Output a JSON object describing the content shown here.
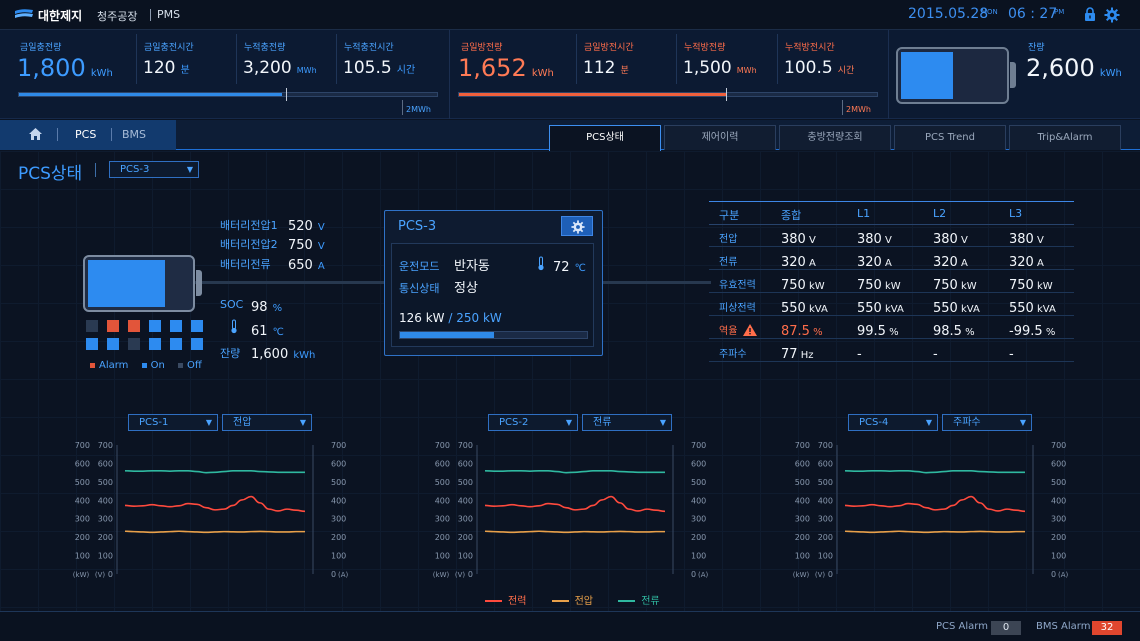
{
  "header": {
    "company": "대한제지",
    "plant": "청주공장",
    "app": "PMS",
    "date": "2015.05.28",
    "day": "MON",
    "time": "06 : 27",
    "ampm": "PM"
  },
  "summary": {
    "charge": {
      "today_label": "금일충전량",
      "today_value": "1,800",
      "today_unit": "kWh",
      "time_label": "금일충전시간",
      "time_value": "120",
      "time_unit": "분",
      "cum_label": "누적충전량",
      "cum_value": "3,200",
      "cum_unit": "MWh",
      "cumtime_label": "누적충전시간",
      "cumtime_value": "105.5",
      "cumtime_unit": "시간",
      "progress": 0.63,
      "scale_label": "2MWh"
    },
    "discharge": {
      "today_label": "금일방전량",
      "today_value": "1,652",
      "today_unit": "kWh",
      "time_label": "금일방전시간",
      "time_value": "112",
      "time_unit": "분",
      "cum_label": "누적방전량",
      "cum_value": "1,500",
      "cum_unit": "MWh",
      "cumtime_label": "누적방전시간",
      "cumtime_value": "100.5",
      "cumtime_unit": "시간",
      "progress": 0.64,
      "scale_label": "2MWh"
    },
    "remain": {
      "label": "잔량",
      "value": "2,600",
      "unit": "kWh",
      "level": 0.5
    }
  },
  "nav": {
    "home_icon": "home-icon",
    "items": [
      "PCS",
      "BMS"
    ],
    "tabs": [
      "PCS상태",
      "제어이력",
      "충방전량조회",
      "PCS Trend",
      "Trip&Alarm"
    ]
  },
  "main": {
    "title": "PCS상태",
    "selector": "PCS-3",
    "battery": {
      "v1_label": "배터리전압1",
      "v1_value": "520",
      "v1_unit": "V",
      "v2_label": "배터리전압2",
      "v2_value": "750",
      "v2_unit": "V",
      "cur_label": "배터리전류",
      "cur_value": "650",
      "cur_unit": "A",
      "soc_label": "SOC",
      "soc_value": "98",
      "soc_unit": "%",
      "temp_value": "61",
      "temp_unit": "℃",
      "remain_label": "잔량",
      "remain_value": "1,600",
      "remain_unit": "kWh",
      "level": 0.75,
      "cells": [
        [
          "off",
          "alarm",
          "alarm",
          "on",
          "on",
          "on"
        ],
        [
          "on",
          "on",
          "off",
          "on",
          "on",
          "on"
        ]
      ],
      "legend": {
        "alarm": "Alarm",
        "on": "On",
        "off": "Off"
      },
      "colors": {
        "alarm": "#e2553a",
        "on": "#2d8bf0",
        "off": "#2a3a52"
      }
    },
    "pcs_card": {
      "title": "PCS-3",
      "mode_label": "운전모드",
      "mode_value": "반자동",
      "temp_value": "72",
      "temp_unit": "℃",
      "comm_label": "통신상태",
      "comm_value": "정상",
      "power_current": "126 kW",
      "power_sep": "/",
      "power_max": "250 kW",
      "progress": 0.5
    },
    "table": {
      "headers": [
        "구분",
        "종합",
        "L1",
        "L2",
        "L3"
      ],
      "rows": [
        {
          "label": "전압",
          "cells": [
            [
              "380",
              "V"
            ],
            [
              "380",
              "V"
            ],
            [
              "380",
              "V"
            ],
            [
              "380",
              "V"
            ]
          ]
        },
        {
          "label": "전류",
          "cells": [
            [
              "320",
              "A"
            ],
            [
              "320",
              "A"
            ],
            [
              "320",
              "A"
            ],
            [
              "320",
              "A"
            ]
          ]
        },
        {
          "label": "유효전력",
          "cells": [
            [
              "750",
              "kW"
            ],
            [
              "750",
              "kW"
            ],
            [
              "750",
              "kW"
            ],
            [
              "750",
              "kW"
            ]
          ]
        },
        {
          "label": "피상전력",
          "cells": [
            [
              "550",
              "kVA"
            ],
            [
              "550",
              "kVA"
            ],
            [
              "550",
              "kVA"
            ],
            [
              "550",
              "kVA"
            ]
          ]
        },
        {
          "label": "역율",
          "alert": true,
          "cells": [
            [
              "87.5",
              "%"
            ],
            [
              "99.5",
              "%"
            ],
            [
              "98.5",
              "%"
            ],
            [
              "-99.5",
              "%"
            ]
          ]
        },
        {
          "label": "주파수",
          "cells": [
            [
              "77",
              "Hz"
            ],
            [
              "-",
              ""
            ],
            [
              "-",
              ""
            ],
            [
              "-",
              ""
            ]
          ]
        }
      ]
    }
  },
  "charts_meta": {
    "panels": [
      {
        "device": "PCS-1",
        "measure": "전압"
      },
      {
        "device": "PCS-2",
        "measure": "전류"
      },
      {
        "device": "PCS-4",
        "measure": "주파수"
      }
    ],
    "left_unit_1": "(kW)",
    "left_unit_2": "(V)",
    "right_unit": "(A)",
    "legend": [
      "전력",
      "전압",
      "전류"
    ],
    "colors": [
      "#ff4a3d",
      "#e8a04a",
      "#2fb8a0"
    ]
  },
  "chart_data": [
    {
      "type": "line",
      "title": "PCS-1",
      "xlabel": "",
      "ylabel": "",
      "ylim": [
        0,
        700
      ],
      "y_ticks": [
        0,
        100,
        200,
        300,
        400,
        500,
        600,
        700
      ],
      "x": [
        0,
        1,
        2,
        3,
        4,
        5,
        6,
        7,
        8,
        9,
        10,
        11,
        12,
        13,
        14,
        15,
        16,
        17,
        18,
        19,
        20
      ],
      "series": [
        {
          "name": "전력",
          "values": [
            372,
            368,
            370,
            376,
            370,
            365,
            370,
            382,
            378,
            360,
            348,
            352,
            372,
            402,
            420,
            386,
            352,
            342,
            352,
            346,
            340
          ]
        },
        {
          "name": "전압",
          "values": [
            232,
            230,
            228,
            226,
            228,
            230,
            232,
            230,
            228,
            226,
            228,
            230,
            229,
            228,
            230,
            231,
            230,
            228,
            228,
            230,
            230
          ]
        },
        {
          "name": "전류",
          "values": [
            560,
            558,
            558,
            560,
            560,
            558,
            560,
            560,
            556,
            550,
            552,
            556,
            560,
            560,
            560,
            556,
            554,
            552,
            552,
            552,
            552
          ]
        }
      ]
    },
    {
      "type": "line",
      "title": "PCS-2",
      "xlabel": "",
      "ylabel": "",
      "ylim": [
        0,
        700
      ],
      "y_ticks": [
        0,
        100,
        200,
        300,
        400,
        500,
        600,
        700
      ],
      "x": [
        0,
        1,
        2,
        3,
        4,
        5,
        6,
        7,
        8,
        9,
        10,
        11,
        12,
        13,
        14,
        15,
        16,
        17,
        18,
        19,
        20
      ],
      "series": [
        {
          "name": "전력",
          "values": [
            372,
            368,
            370,
            376,
            370,
            365,
            370,
            382,
            378,
            360,
            348,
            352,
            372,
            402,
            420,
            386,
            352,
            342,
            352,
            346,
            340
          ]
        },
        {
          "name": "전압",
          "values": [
            232,
            230,
            228,
            226,
            228,
            230,
            232,
            230,
            228,
            226,
            228,
            230,
            229,
            228,
            230,
            231,
            230,
            228,
            228,
            230,
            230
          ]
        },
        {
          "name": "전류",
          "values": [
            560,
            558,
            558,
            560,
            560,
            558,
            560,
            560,
            556,
            550,
            552,
            556,
            560,
            560,
            560,
            556,
            554,
            552,
            552,
            552,
            552
          ]
        }
      ]
    },
    {
      "type": "line",
      "title": "PCS-4",
      "xlabel": "",
      "ylabel": "",
      "ylim": [
        0,
        700
      ],
      "y_ticks": [
        0,
        100,
        200,
        300,
        400,
        500,
        600,
        700
      ],
      "x": [
        0,
        1,
        2,
        3,
        4,
        5,
        6,
        7,
        8,
        9,
        10,
        11,
        12,
        13,
        14,
        15,
        16,
        17,
        18,
        19,
        20
      ],
      "series": [
        {
          "name": "전력",
          "values": [
            372,
            368,
            370,
            376,
            370,
            365,
            370,
            382,
            378,
            360,
            348,
            352,
            372,
            402,
            420,
            386,
            352,
            342,
            352,
            346,
            340
          ]
        },
        {
          "name": "전압",
          "values": [
            232,
            230,
            228,
            226,
            228,
            230,
            232,
            230,
            228,
            226,
            228,
            230,
            229,
            228,
            230,
            231,
            230,
            228,
            228,
            230,
            230
          ]
        },
        {
          "name": "전류",
          "values": [
            560,
            558,
            558,
            560,
            560,
            558,
            560,
            560,
            556,
            550,
            552,
            556,
            560,
            560,
            560,
            556,
            554,
            552,
            552,
            552,
            552
          ]
        }
      ]
    }
  ],
  "footer": {
    "pcs_alarm_label": "PCS Alarm",
    "pcs_alarm_count": "0",
    "bms_alarm_label": "BMS Alarm",
    "bms_alarm_count": "32"
  }
}
